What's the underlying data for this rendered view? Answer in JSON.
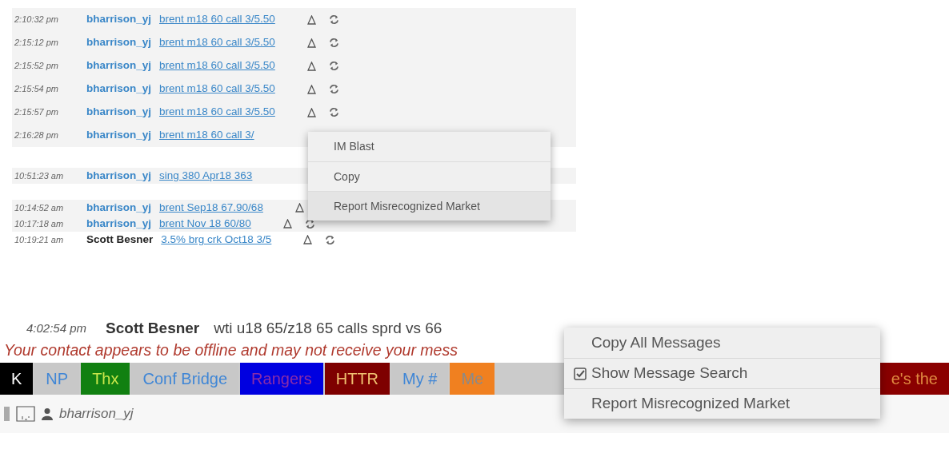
{
  "history": {
    "groups": [
      {
        "rows": [
          {
            "time": "2:10:32 pm",
            "sender": "bharrison_yj",
            "kind": "self",
            "message": "brent m18 60 call 3/5.50",
            "shaded": true,
            "icons": true
          },
          {
            "time": "2:15:12 pm",
            "sender": "bharrison_yj",
            "kind": "self",
            "message": "brent m18 60 call 3/5.50",
            "shaded": true,
            "icons": true
          },
          {
            "time": "2:15:52 pm",
            "sender": "bharrison_yj",
            "kind": "self",
            "message": "brent m18 60 call 3/5.50",
            "shaded": true,
            "icons": true
          },
          {
            "time": "2:15:54 pm",
            "sender": "bharrison_yj",
            "kind": "self",
            "message": "brent m18 60 call 3/5.50",
            "shaded": true,
            "icons": true
          },
          {
            "time": "2:15:57 pm",
            "sender": "bharrison_yj",
            "kind": "self",
            "message": "brent m18 60 call 3/5.50",
            "shaded": true,
            "icons": true
          },
          {
            "time": "2:16:28 pm",
            "sender": "bharrison_yj",
            "kind": "self",
            "message": "brent m18 60 call 3/",
            "shaded": true,
            "icons": false
          }
        ]
      },
      {
        "rows": [
          {
            "time": "10:51:23 am",
            "sender": "bharrison_yj",
            "kind": "self",
            "message": "sing 380 Apr18 363",
            "shaded": true,
            "icons": false
          }
        ]
      },
      {
        "rows": [
          {
            "time": "10:14:52 am",
            "sender": "bharrison_yj",
            "kind": "self",
            "message": "brent Sep18 67.90/68",
            "shaded": true,
            "icons": true
          },
          {
            "time": "10:17:18 am",
            "sender": "bharrison_yj",
            "kind": "self",
            "message": "brent Nov 18 60/80",
            "shaded": true,
            "icons": true
          },
          {
            "time": "10:19:21 am",
            "sender": "Scott Besner",
            "kind": "other",
            "message": "3.5% brg crk Oct18 3/5",
            "shaded": false,
            "icons": true
          }
        ]
      }
    ]
  },
  "message_menu": {
    "items": [
      {
        "label": "IM Blast",
        "highlighted": false
      },
      {
        "label": "Copy",
        "highlighted": false
      },
      {
        "label": "Report Misrecognized Market",
        "highlighted": true
      }
    ]
  },
  "last_message": {
    "time": "4:02:54 pm",
    "sender": "Scott Besner",
    "text": "wti u18 65/z18 65 calls sprd vs 66"
  },
  "warning": "Your contact appears to be offline and may not receive your mess",
  "quick_tags": [
    {
      "label": {
        "text": "K",
        "color": "#ffffff"
      },
      "color": "#000000"
    },
    {
      "label": {
        "text": "NP",
        "color": "#3f86d6"
      },
      "color": "#c8c8c8"
    },
    {
      "label": {
        "text": "Thx",
        "color": "#c8e64a"
      },
      "color": "#118011"
    },
    {
      "label": {
        "text": "Conf Bridge",
        "color": "#3f86d6"
      },
      "color": "#c8c8c8"
    },
    {
      "label": {
        "text": "Rangers",
        "color": "#8a2ca8"
      },
      "color": "#0000e0"
    },
    {
      "label": {
        "text": "HTTR",
        "color": "#f0c070"
      },
      "color": "#7e0000"
    },
    {
      "label": {
        "text": "My #",
        "color": "#3f86d6"
      },
      "color": "#c8c8c8"
    },
    {
      "label": {
        "text": "Me",
        "color": "#8a8a8a"
      },
      "color": "#f08020"
    },
    {
      "label": {
        "text": "e's the",
        "color": "#e08a40"
      },
      "color": "#8a0000"
    }
  ],
  "status": {
    "user": "bharrison_yj"
  },
  "chat_menu": {
    "items": [
      {
        "label": "Copy All Messages",
        "kind": "action"
      },
      {
        "label": "Show Message Search",
        "kind": "check",
        "checked": true
      },
      {
        "label": "Report Misrecognized Market",
        "kind": "action"
      }
    ]
  }
}
